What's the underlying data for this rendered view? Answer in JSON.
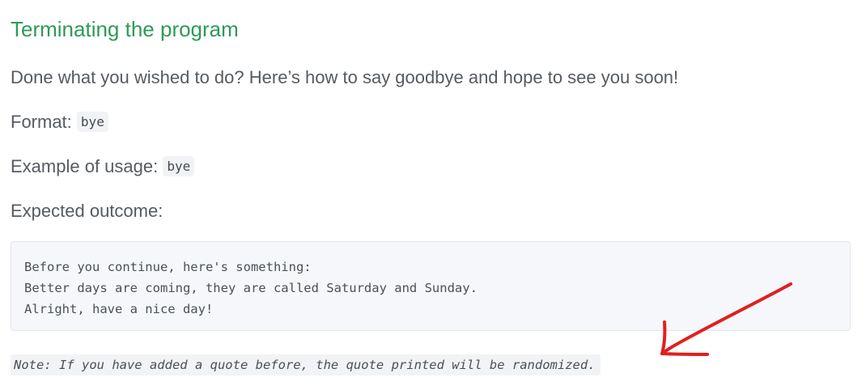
{
  "section": {
    "title": "Terminating the program",
    "intro": "Done what you wished to do? Here’s how to say goodbye and hope to see you soon!",
    "format_label": "Format:",
    "format_code": "bye",
    "example_label": "Example of usage:",
    "example_code": "bye",
    "outcome_label": "Expected outcome:",
    "code_lines": [
      "Before you continue, here's something:",
      "Better days are coming, they are called Saturday and Sunday.",
      "Alright, have a nice day!"
    ],
    "note": "Note: If you have added a quote before, the quote printed will be randomized."
  },
  "colors": {
    "heading": "#2e9a57",
    "body_text": "#555b61",
    "code_background": "#f5f7fa",
    "annotation_arrow": "#e02020"
  },
  "annotation": {
    "icon": "red-arrow-icon"
  }
}
